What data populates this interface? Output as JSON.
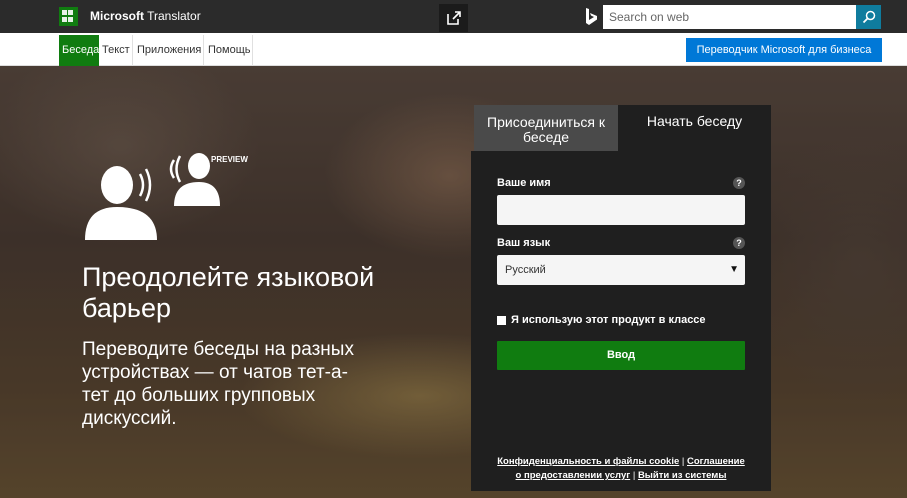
{
  "header": {
    "brand_bold": "Microsoft",
    "brand_rest": " Translator",
    "search_placeholder": "Search on web"
  },
  "nav": {
    "tabs": [
      {
        "label": "Беседа",
        "active": true
      },
      {
        "label": "Текст",
        "active": false
      },
      {
        "label": "Приложения",
        "active": false
      },
      {
        "label": "Помощь",
        "active": false
      }
    ],
    "business_button": "Переводчик Microsoft для бизнеса"
  },
  "hero": {
    "preview_badge": "PREVIEW",
    "headline": "Преодолейте языковой барьер",
    "subtext": "Переводите беседы на разных устройствах — от чатов тет-а-тет до больших групповых дискуссий."
  },
  "panel": {
    "tab_join": "Присоединиться к беседе",
    "tab_start": "Начать беседу",
    "name_label": "Ваше имя",
    "name_value": "",
    "language_label": "Ваш язык",
    "language_value": "Русский",
    "help_glyph": "?",
    "classroom_label": "Я использую этот продукт в классе",
    "classroom_checked": false,
    "enter_button": "Ввод",
    "footer_link_privacy": "Конфиденциальность и файлы cookie",
    "footer_link_terms": "Соглашение о предоставлении услуг",
    "footer_link_signout": "Выйти из системы",
    "footer_separator": " | "
  },
  "colors": {
    "topbar": "#2b2b2b",
    "brand_green": "#107c10",
    "business_blue": "#0078d7",
    "search_button": "#0f7c9e"
  }
}
